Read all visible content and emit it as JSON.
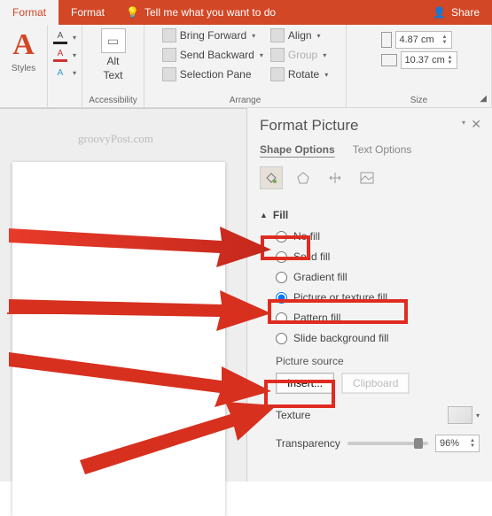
{
  "tabs": {
    "format1": "Format",
    "format2": "Format"
  },
  "ribbonActions": {
    "tellMe": "Tell me what you want to do",
    "share": "Share"
  },
  "groups": {
    "styles": "Styles",
    "accessibility": "Accessibility",
    "arrange": "Arrange",
    "size": "Size"
  },
  "altText": {
    "line1": "Alt",
    "line2": "Text"
  },
  "arrange": {
    "bringForward": "Bring Forward",
    "sendBackward": "Send Backward",
    "selectionPane": "Selection Pane",
    "align": "Align",
    "group": "Group",
    "rotate": "Rotate"
  },
  "size": {
    "height": "4.87 cm",
    "width": "10.37 cm"
  },
  "watermark": "groovyPost.com",
  "pane": {
    "title": "Format Picture",
    "shapeOptions": "Shape Options",
    "textOptions": "Text Options",
    "fill": "Fill",
    "noFill": "No fill",
    "solidFill": "Solid fill",
    "gradientFill": "Gradient fill",
    "pictureFill": "Picture or texture fill",
    "patternFill": "Pattern fill",
    "slideBgFill": "Slide background fill",
    "pictureSource": "Picture source",
    "insert": "Insert...",
    "clipboard": "Clipboard",
    "texture": "Texture",
    "transparency": "Transparency",
    "transparencyValue": "96%"
  }
}
